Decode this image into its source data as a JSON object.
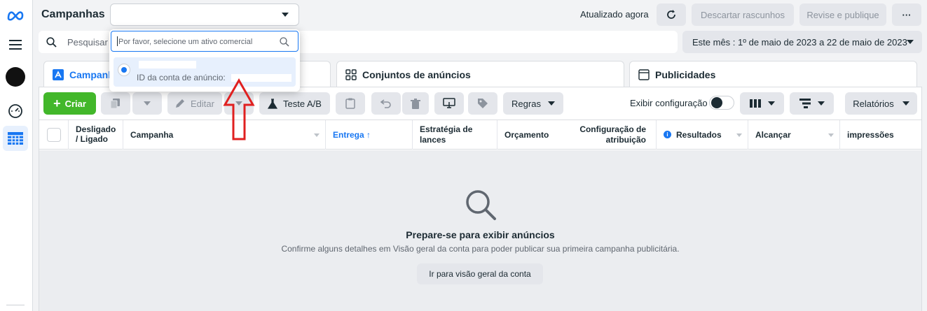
{
  "header": {
    "title": "Campanhas",
    "updated": "Atualizado agora",
    "discard_label": "Descartar rascunhos",
    "review_label": "Revise e publique",
    "more_label": "···"
  },
  "search": {
    "placeholder": "Pesquisar"
  },
  "date_range": {
    "label": "Este mês : 1º de maio de 2023 a 22 de maio de 2023"
  },
  "popover": {
    "search_placeholder": "Por favor, selecione um ativo comercial",
    "option_id_label": "ID da conta de anúncio:"
  },
  "tabs": [
    {
      "label": "Campanhas"
    },
    {
      "label": "Conjuntos de anúncios"
    },
    {
      "label": "Publicidades"
    }
  ],
  "toolbar": {
    "create_label": "Criar",
    "edit_label": "Editar",
    "ab_test_label": "Teste A/B",
    "rules_label": "Regras",
    "show_config_label": "Exibir configuração",
    "reports_label": "Relatórios"
  },
  "table": {
    "columns": [
      {
        "label": "Desligado / Ligado"
      },
      {
        "label": "Campanha"
      },
      {
        "label": "Entrega ↑"
      },
      {
        "label": "Estratégia de lances"
      },
      {
        "label": "Orçamento"
      },
      {
        "label": "Configuração de atribuição"
      },
      {
        "label": "Resultados"
      },
      {
        "label": "Alcançar"
      },
      {
        "label": "impressões"
      }
    ]
  },
  "empty_state": {
    "title": "Prepare-se para exibir anúncios",
    "description": "Confirme alguns detalhes em Visão geral da conta para poder publicar sua primeira campanha publicitária.",
    "button_label": "Ir para visão geral da conta"
  },
  "colors": {
    "primary_green": "#42b72a",
    "accent_blue": "#1877f2",
    "annotation_red": "#e02020"
  }
}
